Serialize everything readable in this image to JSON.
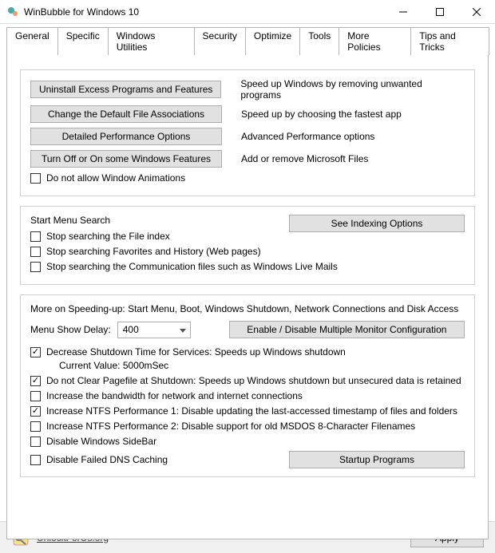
{
  "window": {
    "title": "WinBubble for Windows 10"
  },
  "tabs": [
    "General",
    "Specific",
    "Windows Utilities",
    "Security",
    "Optimize",
    "Tools",
    "More Policies",
    "Tips and Tricks"
  ],
  "active_tab": "Optimize",
  "top_buttons": [
    {
      "label": "Uninstall Excess Programs and Features",
      "desc": "Speed up Windows by removing unwanted programs"
    },
    {
      "label": "Change the Default File Associations",
      "desc": "Speed up by choosing the fastest app"
    },
    {
      "label": "Detailed Performance Options",
      "desc": "Advanced Performance options"
    },
    {
      "label": "Turn Off or On  some Windows Features",
      "desc": "Add or remove Microsoft Files"
    }
  ],
  "animations_chk": "Do not allow Window Animations",
  "start_menu": {
    "title": "Start Menu Search",
    "items": [
      "Stop searching the File index",
      "Stop searching Favorites and History (Web pages)",
      "Stop searching the Communication files such as Windows Live Mails"
    ],
    "see_indexing": "See Indexing Options"
  },
  "speeding": {
    "title": "More on Speeding-up: Start Menu, Boot, Windows Shutdown, Network Connections and Disk Access",
    "menu_delay_label": "Menu Show Delay:",
    "menu_delay_value": "400",
    "monitor_btn": "Enable / Disable Multiple Monitor Configuration",
    "items": [
      {
        "label": "Decrease Shutdown Time for Services: Speeds up Windows shutdown",
        "checked": true,
        "sub": "Current Value: 5000mSec"
      },
      {
        "label": "Do not Clear Pagefile at Shutdown: Speeds up Windows shutdown but unsecured data is retained",
        "checked": true
      },
      {
        "label": "Increase the bandwidth for network and internet connections",
        "checked": false
      },
      {
        "label": "Increase NTFS Performance 1: Disable updating the last-accessed timestamp of files and folders",
        "checked": true
      },
      {
        "label": "Increase NTFS Performance 2: Disable support for old MSDOS 8-Character Filenames",
        "checked": false
      },
      {
        "label": "Disable Windows SideBar",
        "checked": false
      },
      {
        "label": "Disable Failed DNS Caching",
        "checked": false
      }
    ],
    "startup_btn": "Startup Programs"
  },
  "footer": {
    "link": "UnlockForUs.org",
    "apply": "Apply"
  }
}
